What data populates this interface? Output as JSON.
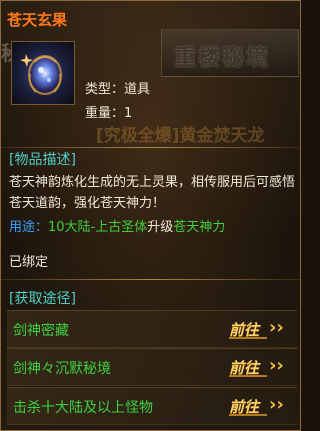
{
  "item": {
    "name": "苍天玄果",
    "type_text": "类型：道具",
    "weight_text": "重量：1",
    "icon": "mystic-fruit-icon"
  },
  "background": {
    "banner_left": "秘境",
    "banner_right": "重楼秘境",
    "watermark": "[究极全爆]黄金焚天龙"
  },
  "description": {
    "header": "[物品描述]",
    "text": "苍天神韵炼化生成的无上灵果，相传服用后可感悟苍天道韵，强化苍天神力！",
    "use_label": "用途：",
    "use_target": "10大陆-上古圣体",
    "use_mid": "升级",
    "use_result": "苍天神力"
  },
  "bound_text": "已绑定",
  "obtain": {
    "header": "[获取途径]",
    "routes": [
      {
        "label": "剑神密藏",
        "go": "前往"
      },
      {
        "label": "剑神々沉默秘境",
        "go": "前往"
      },
      {
        "label": "击杀十大陆及以上怪物",
        "go": "前往"
      }
    ],
    "arrow": "››"
  },
  "colors": {
    "title": "#ff7a1a",
    "section": "#4fd0c8",
    "green": "#40d040",
    "blue": "#3aa0ff",
    "gold": "#ffd36a"
  }
}
